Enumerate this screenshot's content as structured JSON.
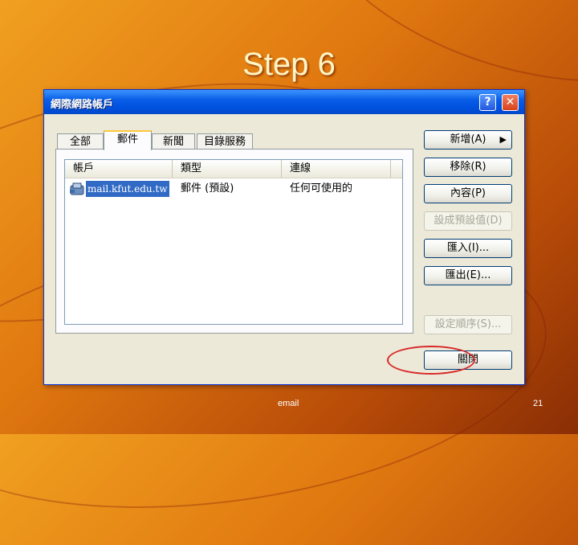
{
  "slide": {
    "title": "Step 6",
    "footer_center": "email",
    "page_number": "21"
  },
  "window": {
    "title": "網際網路帳戶",
    "help_glyph": "?",
    "close_glyph": "✕",
    "tabs": [
      {
        "label": "全部"
      },
      {
        "label": "郵件"
      },
      {
        "label": "新聞"
      },
      {
        "label": "目錄服務"
      }
    ],
    "active_tab": "郵件",
    "list": {
      "columns": [
        "帳戶",
        "類型",
        "連線"
      ],
      "rows": [
        {
          "account": "mail.kfut.edu.tw",
          "type": "郵件 (預設)",
          "connection": "任何可使用的",
          "selected": true
        }
      ]
    },
    "buttons": {
      "add": "新增(A)",
      "add_arrow": "▶",
      "remove": "移除(R)",
      "properties": "內容(P)",
      "set_default": "設成預設值(D)",
      "import": "匯入(I)...",
      "export": "匯出(E)...",
      "set_order": "設定順序(S)...",
      "close": "關閉"
    },
    "highlight_color": "#d8282a"
  }
}
